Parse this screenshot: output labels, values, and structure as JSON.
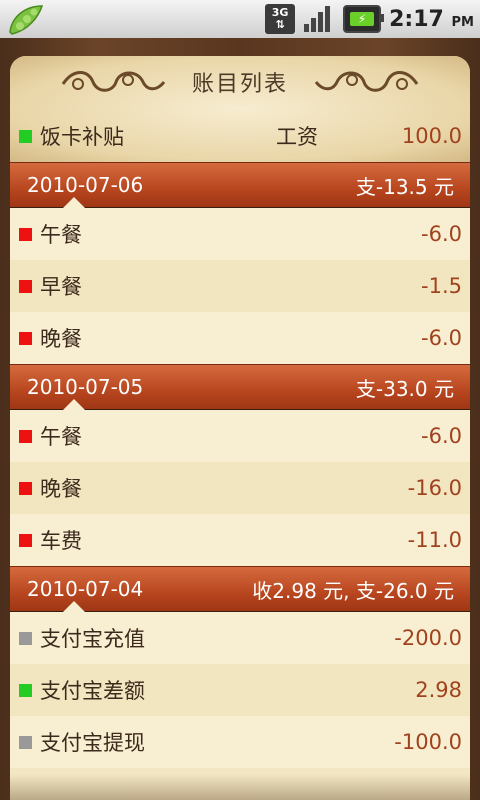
{
  "status_bar": {
    "network": "3G",
    "time": "2:17",
    "ampm": "PM"
  },
  "header": {
    "title": "账目列表"
  },
  "top_entry": {
    "name": "饭卡补贴",
    "category": "工资",
    "amount": "100.0",
    "color": "#22cc22"
  },
  "groups": [
    {
      "date": "2010-07-06",
      "summary": "支-13.5 元",
      "items": [
        {
          "name": "午餐",
          "amount": "-6.0",
          "color": "#ee1111"
        },
        {
          "name": "早餐",
          "amount": "-1.5",
          "color": "#ee1111"
        },
        {
          "name": "晚餐",
          "amount": "-6.0",
          "color": "#ee1111"
        }
      ]
    },
    {
      "date": "2010-07-05",
      "summary": "支-33.0 元",
      "items": [
        {
          "name": "午餐",
          "amount": "-6.0",
          "color": "#ee1111"
        },
        {
          "name": "晚餐",
          "amount": "-16.0",
          "color": "#ee1111"
        },
        {
          "name": "车费",
          "amount": "-11.0",
          "color": "#ee1111"
        }
      ]
    },
    {
      "date": "2010-07-04",
      "summary": "收2.98 元, 支-26.0 元",
      "items": [
        {
          "name": "支付宝充值",
          "amount": "-200.0",
          "color": "#999999"
        },
        {
          "name": "支付宝差额",
          "amount": "2.98",
          "color": "#22cc22"
        },
        {
          "name": "支付宝提现",
          "amount": "-100.0",
          "color": "#999999"
        }
      ]
    }
  ]
}
